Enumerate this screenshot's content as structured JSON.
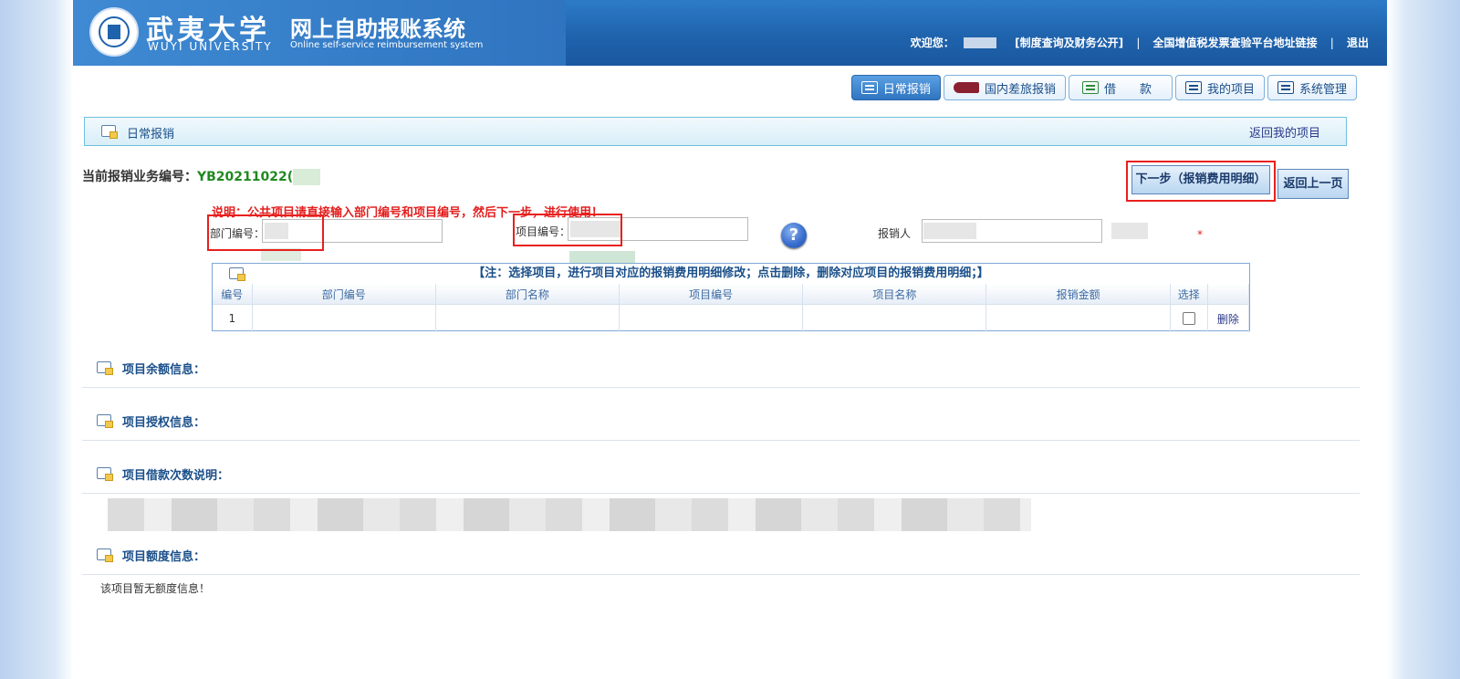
{
  "header": {
    "logo_cn": "武夷大学",
    "logo_en": "WUYI UNIVERSITY",
    "system_cn": "网上自助报账系统",
    "system_en": "Online self-service reimbursement system",
    "welcome": "欢迎您：",
    "link_policy": "[制度查询及财务公开]",
    "link_tax": "全国增值税发票查验平台地址链接",
    "link_logout": "退出",
    "separator": "|"
  },
  "nav": {
    "tabs": [
      {
        "label": "日常报销",
        "icon": "document-icon",
        "active": true
      },
      {
        "label": "国内差旅报销",
        "icon": "train-icon",
        "active": false
      },
      {
        "label": "借　　款",
        "icon": "loan-icon",
        "active": false
      },
      {
        "label": "我的项目",
        "icon": "list-icon",
        "active": false
      },
      {
        "label": "系统管理",
        "icon": "computer-icon",
        "active": false
      }
    ]
  },
  "titlebar": {
    "title": "日常报销",
    "back_link": "返回我的项目"
  },
  "business": {
    "label": "当前报销业务编号：",
    "number": "YB20211022("
  },
  "buttons": {
    "next": "下一步（报销费用明细）",
    "prev": "返回上一页"
  },
  "notice": "说明：公共项目请直接输入部门编号和项目编号，然后下一步，进行使用！",
  "form": {
    "dept_label": "部门编号：",
    "project_label": "项目编号：",
    "help_glyph": "?",
    "applicant_label": "报销人",
    "required_mark": "*"
  },
  "table": {
    "caption": "【注：选择项目，进行项目对应的报销费用明细修改；点击删除，删除对应项目的报销费用明细；】",
    "headers": [
      "编号",
      "部门编号",
      "部门名称",
      "项目编号",
      "项目名称",
      "报销金额",
      "选择",
      ""
    ],
    "rows": [
      {
        "no": "1",
        "dept_no": "",
        "dept_name": "",
        "proj_no": "",
        "proj_name": "",
        "amount": "",
        "delete": "删除"
      }
    ]
  },
  "sections": {
    "balance": "项目余额信息：",
    "auth": "项目授权信息：",
    "loan_times": "项目借款次数说明：",
    "quota": "项目额度信息：",
    "quota_empty": "该项目暂无额度信息！"
  },
  "colors": {
    "header_blue": "#1f63ad",
    "accent_red": "#e41e1e",
    "bizno_green": "#1f8a1f",
    "link_blue": "#2b3a8a"
  }
}
